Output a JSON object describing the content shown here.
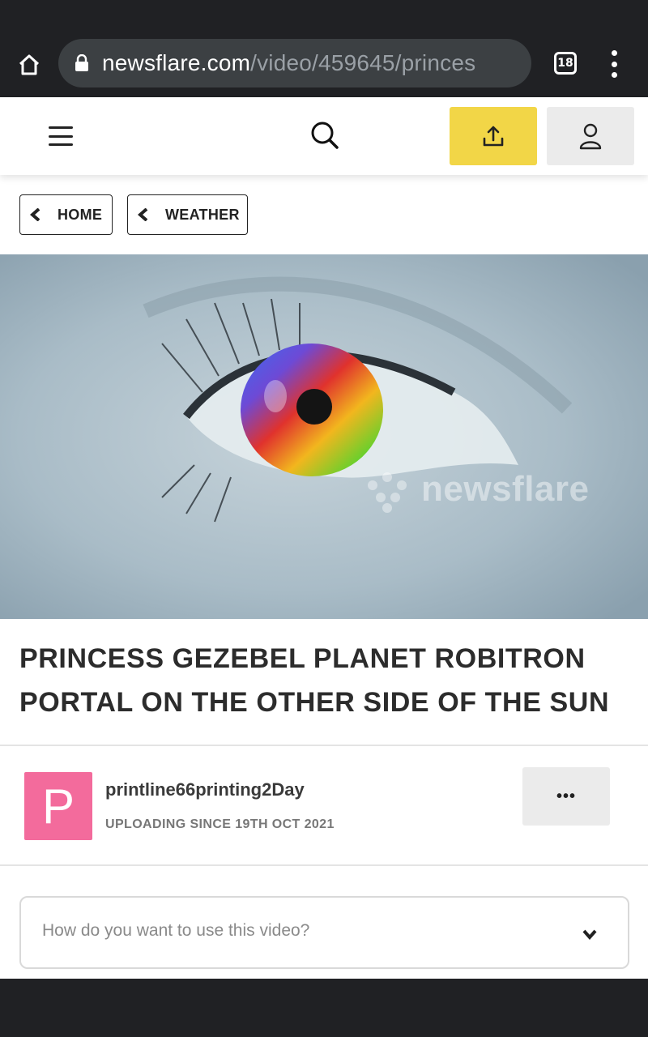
{
  "browser": {
    "url_domain": "newsflare.com",
    "url_path": "/video/459645/princes",
    "tab_count": "18",
    "icons": [
      "home-icon",
      "lock-icon",
      "tabs-icon",
      "menu-icon"
    ]
  },
  "header": {
    "icons": [
      "hamburger-menu-icon",
      "search-icon",
      "upload-icon",
      "user-icon"
    ],
    "colors": {
      "upload": "#f2d647",
      "account": "#ebebeb"
    }
  },
  "breadcrumbs": [
    {
      "label": "HOME"
    },
    {
      "label": "WEATHER"
    }
  ],
  "video": {
    "watermark": "newsflare"
  },
  "title": "PRINCESS GEZEBEL PLANET ROBITRON PORTAL ON THE OTHER SIDE OF THE SUN",
  "uploader": {
    "avatar_letter": "P",
    "avatar_color": "#f36b9c",
    "name": "printline66printing2Day",
    "since": "UPLOADING SINCE 19TH OCT 2021",
    "more_label": "•••"
  },
  "use_select": {
    "placeholder": "How do you want to use this video?"
  }
}
